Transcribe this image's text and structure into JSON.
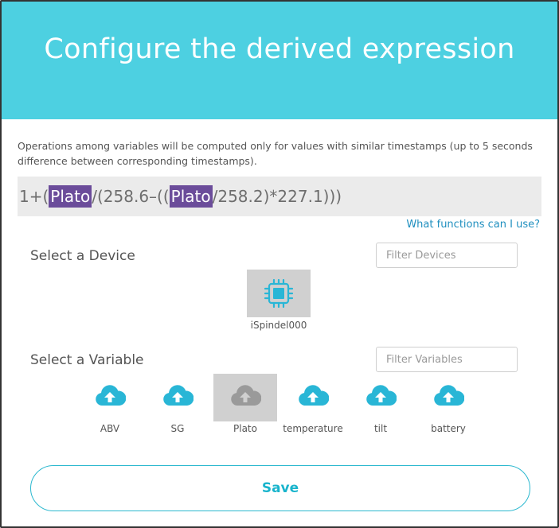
{
  "dialog": {
    "title": "Configure the derived expression",
    "note": "Operations among variables will be computed only for values with similar timestamps (up to 5 seconds difference between corresponding timestamps).",
    "help_link": "What functions can I use?",
    "save_label": "Save"
  },
  "expression": {
    "part1": "1+(",
    "var1": "Plato",
    "part2": " /(258.6–((",
    "var2": "Plato",
    "part3": " /258.2)*227.1)))"
  },
  "devices": {
    "label": "Select a Device",
    "filter_placeholder": "Filter Devices",
    "items": [
      {
        "name": "iSpindel000",
        "icon": "chip-icon",
        "selected": true
      }
    ]
  },
  "variables": {
    "label": "Select a Variable",
    "filter_placeholder": "Filter Variables",
    "items": [
      {
        "name": "ABV",
        "icon": "cloud-upload-icon",
        "selected": false
      },
      {
        "name": "SG",
        "icon": "cloud-upload-icon",
        "selected": false
      },
      {
        "name": "Plato",
        "icon": "cloud-upload-icon",
        "selected": true
      },
      {
        "name": "temperature",
        "icon": "cloud-upload-icon",
        "selected": false
      },
      {
        "name": "tilt",
        "icon": "cloud-upload-icon",
        "selected": false
      },
      {
        "name": "battery",
        "icon": "cloud-upload-icon",
        "selected": false
      }
    ]
  },
  "colors": {
    "header_bg": "#4dd0e1",
    "accent": "#19b4cc",
    "variable_highlight": "#6b4c9a",
    "tile_selected": "#d0d0d0"
  }
}
